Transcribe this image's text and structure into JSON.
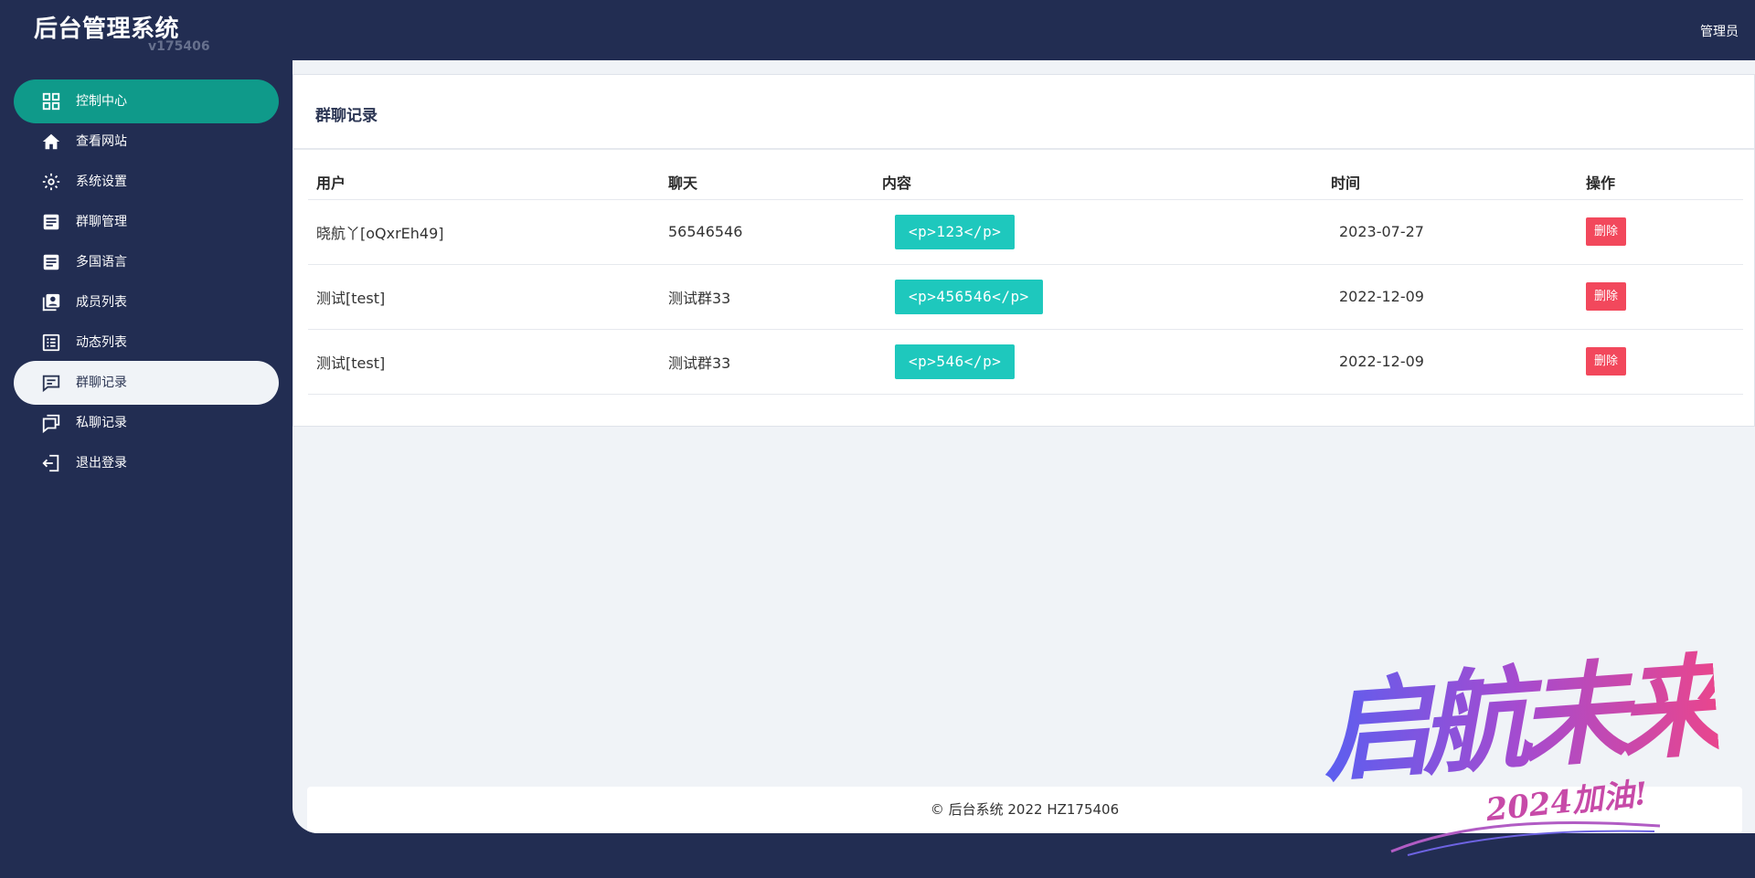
{
  "brand": {
    "title": "后台管理系统",
    "version": "v175406"
  },
  "header": {
    "user": "管理员"
  },
  "sidebar": {
    "items": [
      {
        "label": "控制中心",
        "icon": "dashboard-grid-icon"
      },
      {
        "label": "查看网站",
        "icon": "home-icon"
      },
      {
        "label": "系统设置",
        "icon": "gear-icon"
      },
      {
        "label": "群聊管理",
        "icon": "document-icon"
      },
      {
        "label": "多国语言",
        "icon": "document-icon"
      },
      {
        "label": "成员列表",
        "icon": "contacts-icon"
      },
      {
        "label": "动态列表",
        "icon": "list-icon"
      },
      {
        "label": "群聊记录",
        "icon": "chat-icon"
      },
      {
        "label": "私聊记录",
        "icon": "chats-icon"
      },
      {
        "label": "退出登录",
        "icon": "logout-icon"
      }
    ],
    "active_index": 0,
    "selected_index": 7
  },
  "card": {
    "title": "群聊记录"
  },
  "table": {
    "headers": {
      "user": "用户",
      "chat": "聊天",
      "content": "内容",
      "time": "时间",
      "op": "操作"
    },
    "rows": [
      {
        "user": "晓航丫[oQxrEh49]",
        "chat": "56546546",
        "content": "<p>123</p>",
        "time": "2023-07-27",
        "action": "删除"
      },
      {
        "user": "测试[test]",
        "chat": "测试群33",
        "content": "<p>456546</p>",
        "time": "2022-12-09",
        "action": "删除"
      },
      {
        "user": "测试[test]",
        "chat": "测试群33",
        "content": "<p>546</p>",
        "time": "2022-12-09",
        "action": "删除"
      }
    ]
  },
  "footer": {
    "text": "© 后台系统 2022 HZ175406"
  },
  "watermark": {
    "main": "启航未来",
    "sub": "2024加油!"
  },
  "colors": {
    "sidebar_bg": "#222d52",
    "active_item": "#0f9a8a",
    "tag_bg": "#1ec8bd",
    "delete_bg": "#f2485c",
    "content_bg": "#f0f3f7"
  }
}
